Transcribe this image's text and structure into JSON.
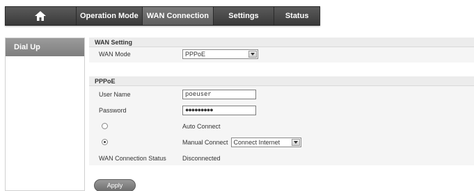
{
  "nav": {
    "home_icon": "home-icon",
    "items": [
      "Operation Mode",
      "WAN Connection",
      "Settings",
      "Status"
    ],
    "active": "WAN Connection"
  },
  "sidebar": {
    "items": [
      {
        "label": "Dial Up"
      }
    ]
  },
  "wan_setting": {
    "title": "WAN Setting",
    "mode_label": "WAN Mode",
    "mode_value": "PPPoE"
  },
  "pppoe": {
    "title": "PPPoE",
    "username_label": "User Name",
    "username_value": "poeuser",
    "password_label": "Password",
    "password_value": "●●●●●●●●●",
    "auto_connect_label": "Auto Connect",
    "auto_connect_selected": false,
    "manual_connect_label": "Manual Connect",
    "manual_connect_selected": true,
    "manual_connect_option": "Connect Internet",
    "status_label": "WAN Connection Status",
    "status_value": "Disconnected"
  },
  "actions": {
    "apply_label": "Apply"
  },
  "colors": {
    "nav_bg": "#4a4a4a",
    "nav_active": "#6b6b6b",
    "sidebar_active": "#8c8c8c",
    "panel_bg": "#f5f5f5",
    "button_bg": "#808080"
  }
}
